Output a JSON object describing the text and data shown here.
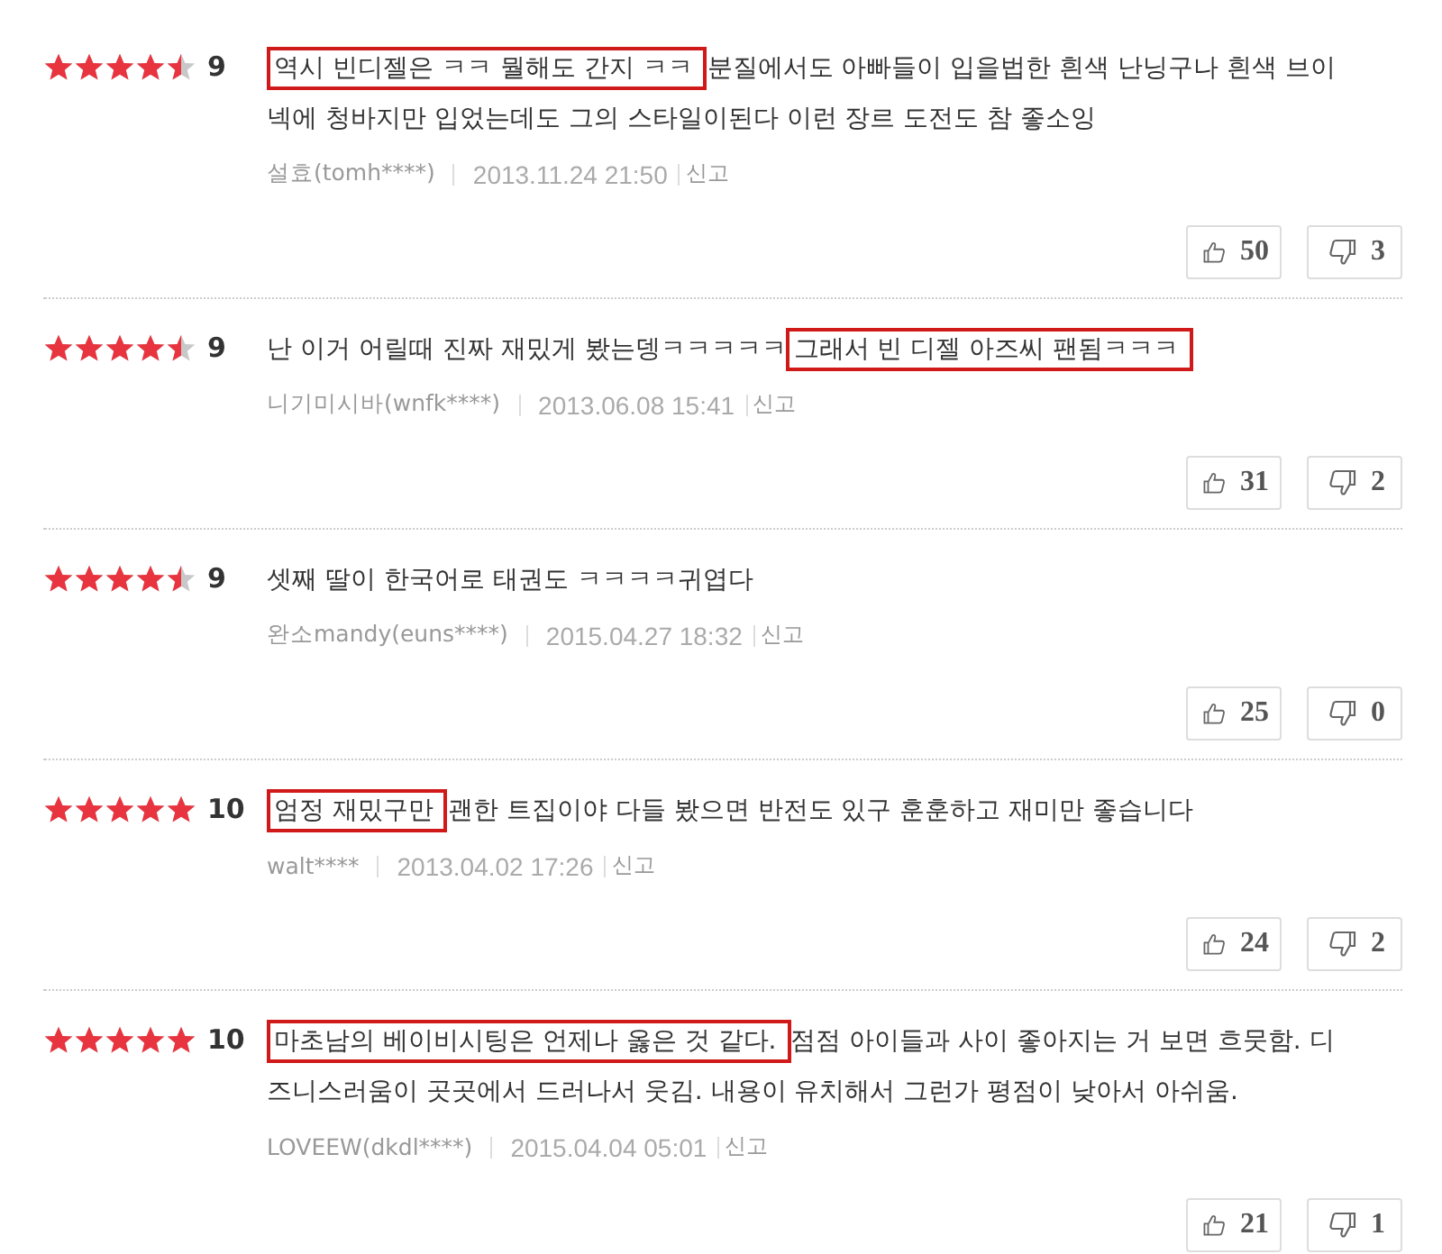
{
  "reviews": [
    {
      "stars": 4.5,
      "score": "9",
      "highlight": "역시 빈디젤은 ㅋㅋ 뭘해도 간지 ㅋㅋ",
      "after": "분질에서도 아빠들이 입을법한 흰색 난닝구나 흰색 브이넥에 청바지만 입었는데도 그의 스타일이된다 이런 장르 도전도 참 좋소잉",
      "author": "설효(tomh****)",
      "date": "2013.11.24 21:50",
      "report": "신고",
      "likes": "50",
      "dislikes": "3"
    },
    {
      "stars": 4.5,
      "score": "9",
      "highlight": "그래서 빈 디젤 아즈씨 팬됨ㅋㅋㅋ",
      "before": "난 이거 어릴때 진짜 재밌게 봤는뎅ㅋㅋㅋㅋㅋ",
      "author": "니기미시바(wnfk****)",
      "date": "2013.06.08 15:41",
      "report": "신고",
      "likes": "31",
      "dislikes": "2"
    },
    {
      "stars": 4.5,
      "score": "9",
      "before": "셋째 딸이 한국어로 태권도 ㅋㅋㅋㅋ귀엽다",
      "author": "완소mandy(euns****)",
      "date": "2015.04.27 18:32",
      "report": "신고",
      "likes": "25",
      "dislikes": "0"
    },
    {
      "stars": 5,
      "score": "10",
      "highlight": "엄정 재밌구만",
      "after": "괜한 트집이야 다들 봤으면 반전도 있구 훈훈하고 재미만 좋습니다",
      "author": "walt****",
      "date": "2013.04.02 17:26",
      "report": "신고",
      "likes": "24",
      "dislikes": "2"
    },
    {
      "stars": 5,
      "score": "10",
      "highlight": "마초남의 베이비시팅은 언제나 옳은 것 같다.",
      "after": "점점 아이들과 사이 좋아지는 거 보면 흐뭇함. 디즈니스러움이 곳곳에서 드러나서 웃김. 내용이 유치해서 그런가 평점이 낮아서 아쉬움.",
      "author": "LOVEEW(dkdl****)",
      "date": "2015.04.04 05:01",
      "report": "신고",
      "likes": "21",
      "dislikes": "1"
    }
  ]
}
